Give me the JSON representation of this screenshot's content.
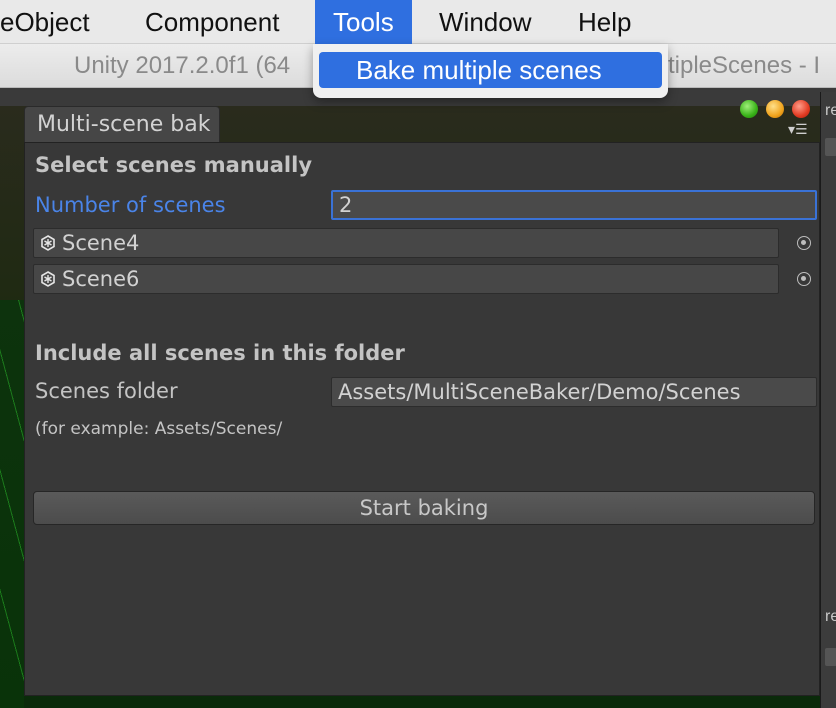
{
  "menubar": {
    "items": [
      {
        "label": "eObject"
      },
      {
        "label": "Component"
      },
      {
        "label": "Tools"
      },
      {
        "label": "Window"
      },
      {
        "label": "Help"
      }
    ]
  },
  "titlebar": {
    "title_left": "Unity 2017.2.0f1 (64",
    "title_right": "tipleScenes - I"
  },
  "dropdown": {
    "item_label": "Bake multiple scenes"
  },
  "window": {
    "tab_label": "Multi-scene bak",
    "manual": {
      "heading": "Select scenes manually",
      "count_label": "Number of scenes",
      "count_value": "2",
      "scenes": [
        "Scene4",
        "Scene6"
      ]
    },
    "folder": {
      "heading": "Include all scenes in this folder",
      "folder_label": "Scenes folder",
      "folder_value": "Assets/MultiSceneBaker/Demo/Scenes",
      "hint": "(for example: Assets/Scenes/"
    },
    "start_label": "Start baking"
  },
  "background": {
    "right_panel_text_1": "re",
    "right_panel_text_2": "re"
  },
  "colors": {
    "accent": "#2f6fe0",
    "focus_label": "#4a84e8",
    "panel_bg": "#383838"
  }
}
